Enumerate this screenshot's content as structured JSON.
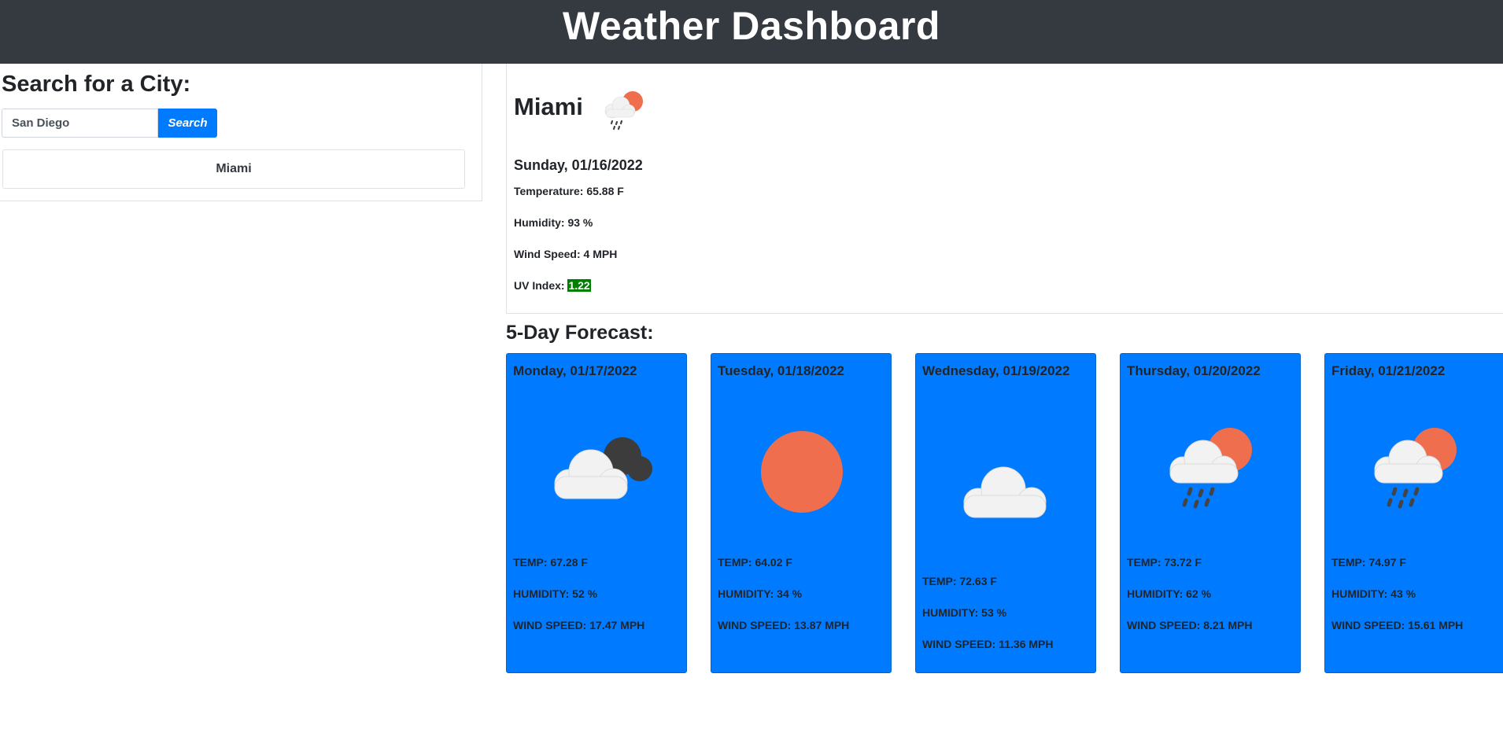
{
  "header": {
    "title": "Weather Dashboard"
  },
  "search": {
    "title": "Search for a City:",
    "input_value": "San Diego",
    "button_label": "Search",
    "history": [
      "Miami"
    ]
  },
  "current": {
    "city": "Miami",
    "icon": "rain-sun-cloud-icon",
    "date": "Sunday, 01/16/2022",
    "temperature_label": "Temperature:",
    "temperature_value": "65.88 F",
    "humidity_label": "Humidity:",
    "humidity_value": "93 %",
    "wind_label": "Wind Speed:",
    "wind_value": "4 MPH",
    "uv_label": "UV Index:",
    "uv_value": "1.22",
    "uv_color": "#008000"
  },
  "forecast": {
    "title": "5-Day Forecast:",
    "card_color": "#007bff",
    "days": [
      {
        "date": "Monday, 01/17/2022",
        "icon": "cloudy-icon",
        "temp": "TEMP: 67.28 F",
        "humidity": "HUMIDITY: 52 %",
        "wind": "WIND SPEED: 17.47 MPH"
      },
      {
        "date": "Tuesday, 01/18/2022",
        "icon": "sun-icon",
        "temp": "TEMP: 64.02 F",
        "humidity": "HUMIDITY: 34 %",
        "wind": "WIND SPEED: 13.87 MPH"
      },
      {
        "date": "Wednesday, 01/19/2022",
        "icon": "cloud-icon",
        "temp": "TEMP: 72.63 F",
        "humidity": "HUMIDITY: 53 %",
        "wind": "WIND SPEED: 11.36 MPH"
      },
      {
        "date": "Thursday, 01/20/2022",
        "icon": "rain-sun-cloud-icon",
        "temp": "TEMP: 73.72 F",
        "humidity": "HUMIDITY: 62 %",
        "wind": "WIND SPEED: 8.21 MPH"
      },
      {
        "date": "Friday, 01/21/2022",
        "icon": "rain-sun-cloud-icon",
        "temp": "TEMP: 74.97 F",
        "humidity": "HUMIDITY: 43 %",
        "wind": "WIND SPEED: 15.61 MPH"
      }
    ]
  }
}
